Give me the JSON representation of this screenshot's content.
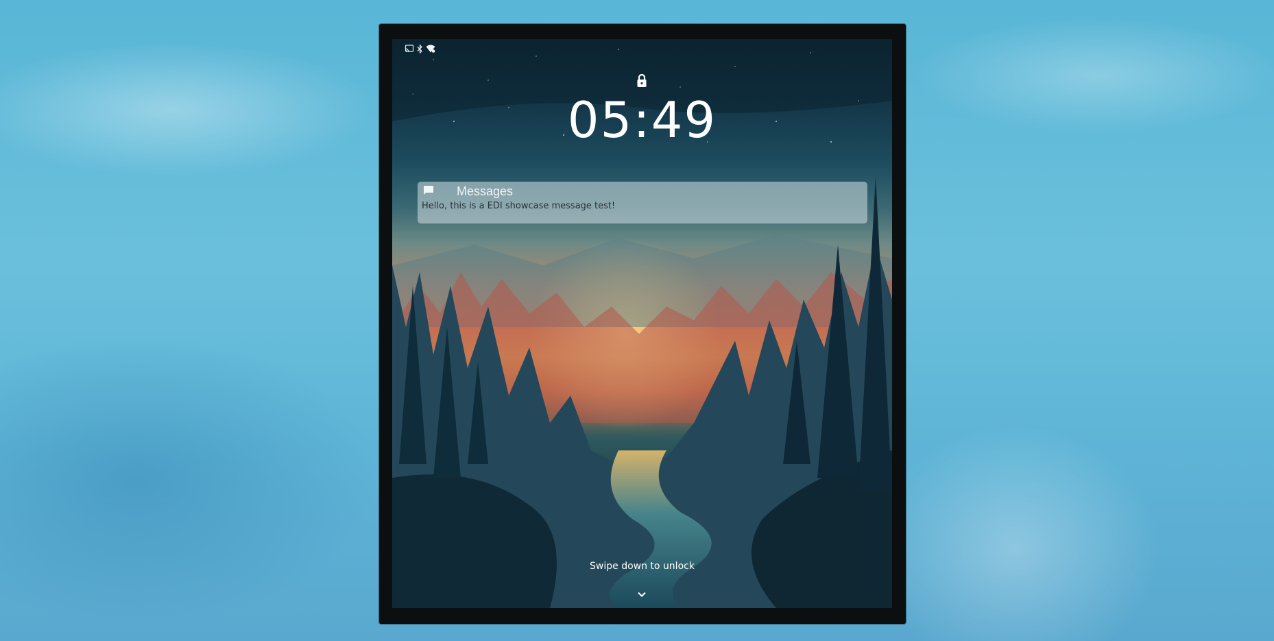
{
  "status_bar": {
    "icons": [
      "cast-icon",
      "bluetooth-icon",
      "wifi-icon"
    ]
  },
  "lock_screen": {
    "time": "05:49",
    "unlock_hint": "Swipe down to unlock"
  },
  "notification": {
    "app_icon": "message-icon",
    "app_name": "Messages",
    "message": "Hello, this is a EDI showcase message test!"
  },
  "colors": {
    "desktop_background": "#5eb4d6",
    "device_frame": "#0c0f10",
    "text": "#ffffff"
  }
}
